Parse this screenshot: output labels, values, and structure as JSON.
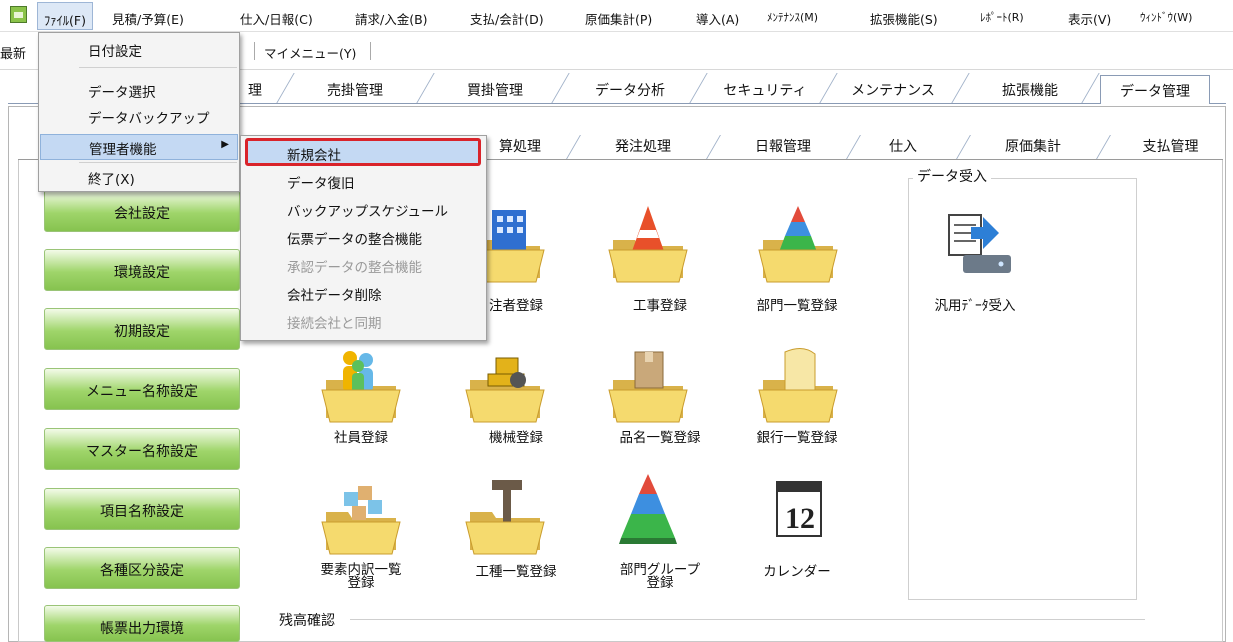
{
  "menubar": {
    "items": [
      "ﾌｧｲﾙ(F)",
      "見積/予算(E)",
      "仕入/日報(C)",
      "請求/入金(B)",
      "支払/会計(D)",
      "原価集計(P)",
      "導入(A)",
      "ﾒﾝﾃﾅﾝｽ(M)",
      "拡張機能(S)",
      "ﾚﾎﾟｰﾄ(R)",
      "表示(V)",
      "ｳｨﾝﾄﾞｳ(W)"
    ]
  },
  "toolbar": {
    "recent_label": "最新",
    "mymenu_label": "マイメニュー(Y)"
  },
  "main_tabs": [
    "理",
    "売掛管理",
    "買掛管理",
    "データ分析",
    "セキュリティ",
    "メンテナンス",
    "拡張機能",
    "データ管理"
  ],
  "sub_tabs": [
    "算処理",
    "発注処理",
    "日報管理",
    "仕入",
    "原価集計",
    "支払管理"
  ],
  "left_buttons": [
    "会社設定",
    "環境設定",
    "初期設定",
    "メニュー名称設定",
    "マスター名称設定",
    "項目名称設定",
    "各種区分設定",
    "帳票出力環境"
  ],
  "icons": {
    "row1": [
      "注者登録",
      "工事登録",
      "部門一覧登録"
    ],
    "row2": [
      "社員登録",
      "機械登録",
      "品名一覧登録",
      "銀行一覧登録"
    ],
    "row3": [
      "要素内訳一覧\n登録",
      "工種一覧登録",
      "部門グループ\n登録",
      "カレンダー"
    ]
  },
  "import_group": {
    "title": "データ受入",
    "item": "汎用ﾃﾞｰﾀ受入"
  },
  "balance_title": "残高確認",
  "file_menu": {
    "items": [
      "日付設定",
      "データ選択",
      "データバックアップ",
      "管理者機能",
      "終了(X)"
    ]
  },
  "admin_submenu": {
    "items": [
      {
        "label": "新規会社",
        "enabled": true
      },
      {
        "label": "データ復旧",
        "enabled": true
      },
      {
        "label": "バックアップスケジュール",
        "enabled": true
      },
      {
        "label": "伝票データの整合機能",
        "enabled": true
      },
      {
        "label": "承認データの整合機能",
        "enabled": false
      },
      {
        "label": "会社データ削除",
        "enabled": true
      },
      {
        "label": "接続会社と同期",
        "enabled": false
      }
    ]
  },
  "colors": {
    "accent_green": "#9fd56a",
    "highlight": "#c4d9f3",
    "callout_red": "#d9232a"
  }
}
